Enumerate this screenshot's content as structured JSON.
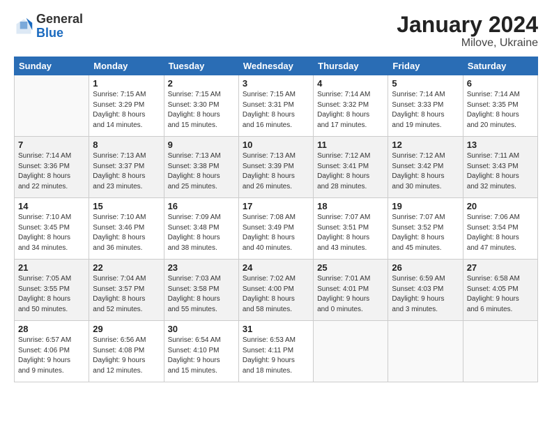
{
  "header": {
    "logo_general": "General",
    "logo_blue": "Blue",
    "title": "January 2024",
    "subtitle": "Milove, Ukraine"
  },
  "days_of_week": [
    "Sunday",
    "Monday",
    "Tuesday",
    "Wednesday",
    "Thursday",
    "Friday",
    "Saturday"
  ],
  "weeks": [
    [
      {
        "day": "",
        "info": ""
      },
      {
        "day": "1",
        "info": "Sunrise: 7:15 AM\nSunset: 3:29 PM\nDaylight: 8 hours\nand 14 minutes."
      },
      {
        "day": "2",
        "info": "Sunrise: 7:15 AM\nSunset: 3:30 PM\nDaylight: 8 hours\nand 15 minutes."
      },
      {
        "day": "3",
        "info": "Sunrise: 7:15 AM\nSunset: 3:31 PM\nDaylight: 8 hours\nand 16 minutes."
      },
      {
        "day": "4",
        "info": "Sunrise: 7:14 AM\nSunset: 3:32 PM\nDaylight: 8 hours\nand 17 minutes."
      },
      {
        "day": "5",
        "info": "Sunrise: 7:14 AM\nSunset: 3:33 PM\nDaylight: 8 hours\nand 19 minutes."
      },
      {
        "day": "6",
        "info": "Sunrise: 7:14 AM\nSunset: 3:35 PM\nDaylight: 8 hours\nand 20 minutes."
      }
    ],
    [
      {
        "day": "7",
        "info": "Sunrise: 7:14 AM\nSunset: 3:36 PM\nDaylight: 8 hours\nand 22 minutes."
      },
      {
        "day": "8",
        "info": "Sunrise: 7:13 AM\nSunset: 3:37 PM\nDaylight: 8 hours\nand 23 minutes."
      },
      {
        "day": "9",
        "info": "Sunrise: 7:13 AM\nSunset: 3:38 PM\nDaylight: 8 hours\nand 25 minutes."
      },
      {
        "day": "10",
        "info": "Sunrise: 7:13 AM\nSunset: 3:39 PM\nDaylight: 8 hours\nand 26 minutes."
      },
      {
        "day": "11",
        "info": "Sunrise: 7:12 AM\nSunset: 3:41 PM\nDaylight: 8 hours\nand 28 minutes."
      },
      {
        "day": "12",
        "info": "Sunrise: 7:12 AM\nSunset: 3:42 PM\nDaylight: 8 hours\nand 30 minutes."
      },
      {
        "day": "13",
        "info": "Sunrise: 7:11 AM\nSunset: 3:43 PM\nDaylight: 8 hours\nand 32 minutes."
      }
    ],
    [
      {
        "day": "14",
        "info": "Sunrise: 7:10 AM\nSunset: 3:45 PM\nDaylight: 8 hours\nand 34 minutes."
      },
      {
        "day": "15",
        "info": "Sunrise: 7:10 AM\nSunset: 3:46 PM\nDaylight: 8 hours\nand 36 minutes."
      },
      {
        "day": "16",
        "info": "Sunrise: 7:09 AM\nSunset: 3:48 PM\nDaylight: 8 hours\nand 38 minutes."
      },
      {
        "day": "17",
        "info": "Sunrise: 7:08 AM\nSunset: 3:49 PM\nDaylight: 8 hours\nand 40 minutes."
      },
      {
        "day": "18",
        "info": "Sunrise: 7:07 AM\nSunset: 3:51 PM\nDaylight: 8 hours\nand 43 minutes."
      },
      {
        "day": "19",
        "info": "Sunrise: 7:07 AM\nSunset: 3:52 PM\nDaylight: 8 hours\nand 45 minutes."
      },
      {
        "day": "20",
        "info": "Sunrise: 7:06 AM\nSunset: 3:54 PM\nDaylight: 8 hours\nand 47 minutes."
      }
    ],
    [
      {
        "day": "21",
        "info": "Sunrise: 7:05 AM\nSunset: 3:55 PM\nDaylight: 8 hours\nand 50 minutes."
      },
      {
        "day": "22",
        "info": "Sunrise: 7:04 AM\nSunset: 3:57 PM\nDaylight: 8 hours\nand 52 minutes."
      },
      {
        "day": "23",
        "info": "Sunrise: 7:03 AM\nSunset: 3:58 PM\nDaylight: 8 hours\nand 55 minutes."
      },
      {
        "day": "24",
        "info": "Sunrise: 7:02 AM\nSunset: 4:00 PM\nDaylight: 8 hours\nand 58 minutes."
      },
      {
        "day": "25",
        "info": "Sunrise: 7:01 AM\nSunset: 4:01 PM\nDaylight: 9 hours\nand 0 minutes."
      },
      {
        "day": "26",
        "info": "Sunrise: 6:59 AM\nSunset: 4:03 PM\nDaylight: 9 hours\nand 3 minutes."
      },
      {
        "day": "27",
        "info": "Sunrise: 6:58 AM\nSunset: 4:05 PM\nDaylight: 9 hours\nand 6 minutes."
      }
    ],
    [
      {
        "day": "28",
        "info": "Sunrise: 6:57 AM\nSunset: 4:06 PM\nDaylight: 9 hours\nand 9 minutes."
      },
      {
        "day": "29",
        "info": "Sunrise: 6:56 AM\nSunset: 4:08 PM\nDaylight: 9 hours\nand 12 minutes."
      },
      {
        "day": "30",
        "info": "Sunrise: 6:54 AM\nSunset: 4:10 PM\nDaylight: 9 hours\nand 15 minutes."
      },
      {
        "day": "31",
        "info": "Sunrise: 6:53 AM\nSunset: 4:11 PM\nDaylight: 9 hours\nand 18 minutes."
      },
      {
        "day": "",
        "info": ""
      },
      {
        "day": "",
        "info": ""
      },
      {
        "day": "",
        "info": ""
      }
    ]
  ]
}
